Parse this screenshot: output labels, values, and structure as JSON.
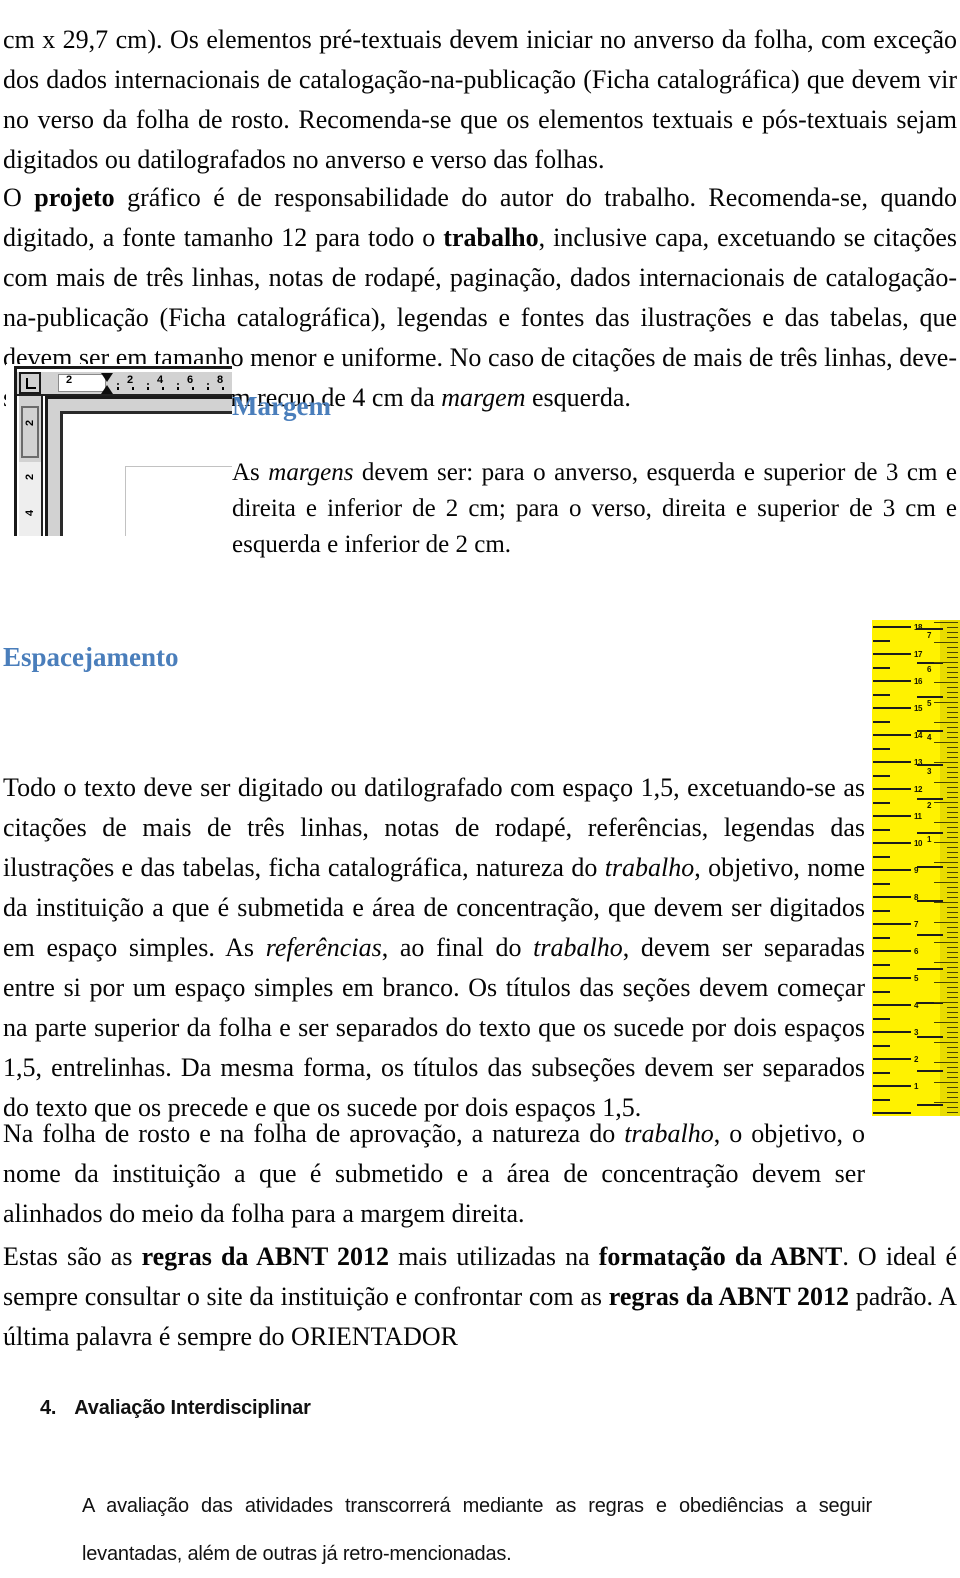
{
  "document": {
    "language": "pt-BR",
    "accent_color": "#4A7EBB",
    "body_color": "#050505"
  },
  "paragraphs": {
    "intro": "cm x 29,7 cm). Os elementos pré-textuais devem iniciar no anverso da folha, com exceção dos dados internacionais de catalogação-na-publicação (Ficha catalográfica) que devem vir no verso da folha de rosto. Recomenda-se que os elementos textuais e pós-textuais sejam digitados ou datilografados no anverso e verso das folhas.",
    "projeto_part1": "O ",
    "projeto_bold1": "projeto",
    "projeto_part2": " gráfico é de responsabilidade do autor do trabalho. Recomenda-se, quando digitado, a fonte tamanho 12 para todo o ",
    "projeto_bold2": "trabalho",
    "projeto_part3": ", inclusive capa, excetuando se citações com mais de três linhas, notas de rodapé, paginação, dados internacionais de catalogação-na-publicação (Ficha catalográfica), legendas e fontes das ilustrações e das tabelas, que devem ser em tamanho menor e uniforme. No caso de citações de mais de três linhas, deve-se observar também um recuo de 4 cm da ",
    "projeto_italic1": "margem",
    "projeto_part4": " esquerda.",
    "margem_part1": "As ",
    "margem_italic1": "margens",
    "margem_part2": " devem ser: para o anverso, esquerda e superior de 3 cm e direita e inferior de 2 cm; para o verso, direita e superior de 3 cm e esquerda e inferior de 2 cm.",
    "espacejamento_part1": "Todo o texto deve ser digitado ou datilografado com espaço 1,5, excetuando-se as citações de mais de três linhas, notas de rodapé, referências, legendas das ilustrações e das tabelas, ficha catalográfica, natureza do ",
    "espacejamento_italic1": "trabalho",
    "espacejamento_part2": ", objetivo, nome da instituição a que é submetida e área de concentração, que devem ser digitados em espaço simples. As ",
    "espacejamento_italic2": "referências",
    "espacejamento_part3": ", ao final do ",
    "espacejamento_italic3": "trabalho",
    "espacejamento_part4": ", devem ser separadas entre si por um espaço simples em branco. Os títulos das seções devem começar na parte superior da folha e ser separados do texto que os sucede por dois espaços 1,5, entrelinhas. Da mesma forma, os títulos das subseções devem ser separados do texto que os precede e que os sucede por dois espaços 1,5.",
    "folharosto_part1": "Na folha de rosto e na folha de aprovação, a natureza do ",
    "folharosto_italic1": "trabalho",
    "folharosto_part2": ", o objetivo, o nome da instituição a que é submetido e a área de concentração devem ser alinhados do meio da folha para a margem direita.",
    "regras_part1": "Estas são as ",
    "regras_bold1": "regras da ABNT 2012",
    "regras_part2": " mais utilizadas na ",
    "regras_bold2": "formatação da ABNT",
    "regras_part3": ". O ideal é sempre consultar o site da instituição e confrontar com as ",
    "regras_bold3": "regras da ABNT 2012",
    "regras_part4": " padrão. A última palavra é sempre do ORIENTADOR",
    "avaliacao": "A avaliação das atividades transcorrerá mediante as regras e obediências a seguir levantadas, além de outras já retro-mencionadas."
  },
  "headings": {
    "margem": "Margem",
    "espacejamento": "Espacejamento",
    "avaliacao_number": "4.",
    "avaliacao_title": "Avaliação Interdisciplinar"
  },
  "ruler_screenshot": {
    "caption": "word-processor-ruler-corner",
    "horizontal_labels": [
      "2",
      "2",
      "4",
      "6",
      "8"
    ],
    "vertical_labels": [
      "2",
      "2",
      "4"
    ],
    "tab_selector_glyph": "L"
  },
  "yellow_ruler": {
    "caption": "yellow-measuring-ruler",
    "background_color": "#FFF200",
    "left_scale_numbers": [
      "18",
      "17",
      "16",
      "15",
      "14",
      "13",
      "12",
      "11",
      "10",
      "9",
      "8",
      "7",
      "6",
      "5",
      "4",
      "3",
      "2",
      "1"
    ],
    "right_scale_numbers": [
      "7",
      "6",
      "5",
      "4",
      "3",
      "2",
      "1"
    ]
  }
}
